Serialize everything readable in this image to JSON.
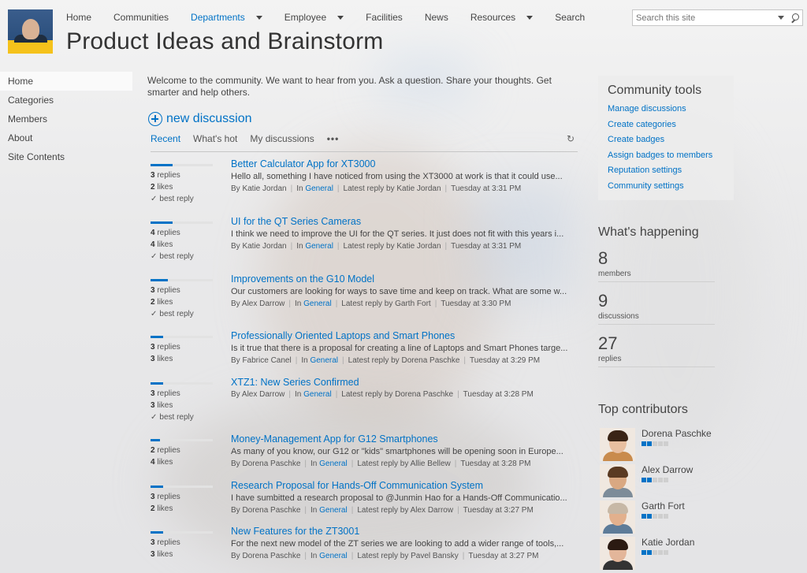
{
  "header": {
    "site_title": "Product Ideas and Brainstorm",
    "nav": [
      {
        "label": "Home",
        "dropdown": false,
        "active": false
      },
      {
        "label": "Communities",
        "dropdown": false,
        "active": false
      },
      {
        "label": "Departments",
        "dropdown": true,
        "active": true
      },
      {
        "label": "Employee",
        "dropdown": true,
        "active": false
      },
      {
        "label": "Facilities",
        "dropdown": false,
        "active": false
      },
      {
        "label": "News",
        "dropdown": false,
        "active": false
      },
      {
        "label": "Resources",
        "dropdown": true,
        "active": false
      },
      {
        "label": "Search",
        "dropdown": false,
        "active": false
      }
    ],
    "search_placeholder": "Search this site"
  },
  "leftnav": {
    "items": [
      {
        "label": "Home",
        "selected": true
      },
      {
        "label": "Categories",
        "selected": false
      },
      {
        "label": "Members",
        "selected": false
      },
      {
        "label": "About",
        "selected": false
      },
      {
        "label": "Site Contents",
        "selected": false
      }
    ]
  },
  "main": {
    "welcome": "Welcome to the community. We want to hear from you. Ask a question. Share your thoughts. Get smarter and help others.",
    "new_discussion": "new discussion",
    "tabs": [
      {
        "label": "Recent",
        "active": true
      },
      {
        "label": "What's hot",
        "active": false
      },
      {
        "label": "My discussions",
        "active": false
      }
    ],
    "more_label": "•••",
    "discussions": [
      {
        "title": "Better Calculator App for XT3000",
        "excerpt": "Hello all, something I have noticed from using the XT3000 at work is that it could use...",
        "author": "Katie Jordan",
        "category": "General",
        "last_reply_by": "Katie Jordan",
        "time": "Tuesday at 3:31 PM",
        "replies": "3",
        "likes": "2",
        "best_reply": true,
        "activity": 0.35
      },
      {
        "title": "UI for the QT Series Cameras",
        "excerpt": "I think we need to improve the UI for the QT series. It just does not fit with this years i...",
        "author": "Katie Jordan",
        "category": "General",
        "last_reply_by": "Katie Jordan",
        "time": "Tuesday at 3:31 PM",
        "replies": "4",
        "likes": "4",
        "best_reply": true,
        "activity": 0.35
      },
      {
        "title": "Improvements on the G10 Model",
        "excerpt": "Our customers are looking for ways to save time and keep on track. What are some w...",
        "author": "Alex Darrow",
        "category": "General",
        "last_reply_by": "Garth Fort",
        "time": "Tuesday at 3:30 PM",
        "replies": "3",
        "likes": "2",
        "best_reply": true,
        "activity": 0.28
      },
      {
        "title": "Professionally Oriented Laptops and Smart Phones",
        "excerpt": "Is it true that there is a proposal for creating a line of Laptops and Smart Phones targe...",
        "author": "Fabrice Canel",
        "category": "General",
        "last_reply_by": "Dorena Paschke",
        "time": "Tuesday at 3:29 PM",
        "replies": "3",
        "likes": "3",
        "best_reply": false,
        "activity": 0.2
      },
      {
        "title": "XTZ1: New Series Confirmed",
        "excerpt": "",
        "author": "Alex Darrow",
        "category": "General",
        "last_reply_by": "Dorena Paschke",
        "time": "Tuesday at 3:28 PM",
        "replies": "3",
        "likes": "3",
        "best_reply": true,
        "activity": 0.2
      },
      {
        "title": "Money-Management App for G12 Smartphones",
        "excerpt": "As many of you know, our G12 or \"kids\" smartphones will be opening soon in Europe...",
        "author": "Dorena Paschke",
        "category": "General",
        "last_reply_by": "Allie Bellew",
        "time": "Tuesday at 3:28 PM",
        "replies": "2",
        "likes": "4",
        "best_reply": false,
        "activity": 0.15
      },
      {
        "title": "Research Proposal for Hands-Off Communication System",
        "excerpt": "I have sumbitted a research proposal to @Junmin Hao for a Hands-Off Communicatio...",
        "author": "Dorena Paschke",
        "category": "General",
        "last_reply_by": "Alex Darrow",
        "time": "Tuesday at 3:27 PM",
        "replies": "3",
        "likes": "2",
        "best_reply": false,
        "activity": 0.2
      },
      {
        "title": "New Features for the ZT3001",
        "excerpt": "For the next new model of the ZT series we are looking to add a wider range of tools,...",
        "author": "Dorena Paschke",
        "category": "General",
        "last_reply_by": "Pavel Bansky",
        "time": "Tuesday at 3:27 PM",
        "replies": "3",
        "likes": "3",
        "best_reply": false,
        "activity": 0.2
      }
    ],
    "labels": {
      "replies": "replies",
      "likes": "likes",
      "best_reply": "best reply",
      "by": "By",
      "in": "In",
      "latest_reply_by": "Latest reply by"
    }
  },
  "right": {
    "tools_title": "Community tools",
    "tools": [
      "Manage discussions",
      "Create categories",
      "Create badges",
      "Assign badges to members",
      "Reputation settings",
      "Community settings"
    ],
    "happening_title": "What's happening",
    "stats": [
      {
        "value": "8",
        "label": "members"
      },
      {
        "value": "9",
        "label": "discussions"
      },
      {
        "value": "27",
        "label": "replies"
      }
    ],
    "contributors_title": "Top contributors",
    "contributors": [
      {
        "name": "Dorena Paschke",
        "level": 2,
        "icon": "dorena-avatar",
        "skin": "#e8bfa0",
        "hair": "#3a2416",
        "shirt": "#c98b4c"
      },
      {
        "name": "Alex Darrow",
        "level": 2,
        "icon": "alex-avatar",
        "skin": "#d9a882",
        "hair": "#5a3a22",
        "shirt": "#7d8c99"
      },
      {
        "name": "Garth Fort",
        "level": 2,
        "icon": "garth-avatar",
        "skin": "#e2b08d",
        "hair": "#c7b8a6",
        "shirt": "#5d7b98"
      },
      {
        "name": "Katie Jordan",
        "level": 2,
        "icon": "katie-avatar",
        "skin": "#e3b69a",
        "hair": "#2b1a12",
        "shirt": "#333333"
      }
    ]
  },
  "colors": {
    "accent": "#0072c6"
  }
}
